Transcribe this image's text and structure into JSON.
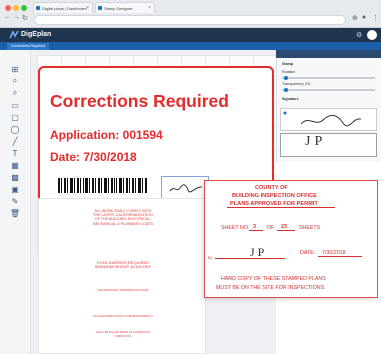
{
  "browser": {
    "tabs": [
      {
        "label": "Digital plans | Dashboard"
      },
      {
        "label": "Stamp Designer"
      }
    ],
    "address": ""
  },
  "app": {
    "brand": "DigEplan",
    "document_tab": "Corrections Required"
  },
  "canvas": {
    "stamp": {
      "title": "Corrections Required",
      "application_line": "Application:  001594",
      "date_line": "Date:  7/30/2018"
    }
  },
  "panel": {
    "section": "Stamp",
    "rotation_label": "Rotation",
    "transparency_label": "Transparency (%)",
    "signature_label": "Signature",
    "signature_text": "JP"
  },
  "document": {
    "notes": [
      "All work shall comply with the latest California edition of the building, electrical, mechanical & plumbing codes",
      "Pool barrier required minimum height 48 inches",
      "For additional information please",
      "Calling inspections is the responsibility",
      "Shall be called prior to foundation inspection"
    ]
  },
  "county_stamp": {
    "line1": "COUNTY OF",
    "line2": "BUILDING INSPECTION OFFICE",
    "line3": "PLANS APPROVED FOR PERMIT",
    "sheet_label": "SHEET NO.",
    "sheet_no": "3",
    "of_label": "OF",
    "sheet_total": "23",
    "sheets_label": "SHEETS",
    "by_label": "BY",
    "by_value": "JP",
    "date_label": "DATE:",
    "date_value": "7/30/2018",
    "footer1": "HARD COPY OF THESE STAMPED PLANS",
    "footer2": "MUST BE ON THE SITE FOR INSPECTIONS."
  },
  "colors": {
    "accent": "#1e6fc0",
    "stamp_red": "#e52b2b",
    "header": "#20354f"
  }
}
